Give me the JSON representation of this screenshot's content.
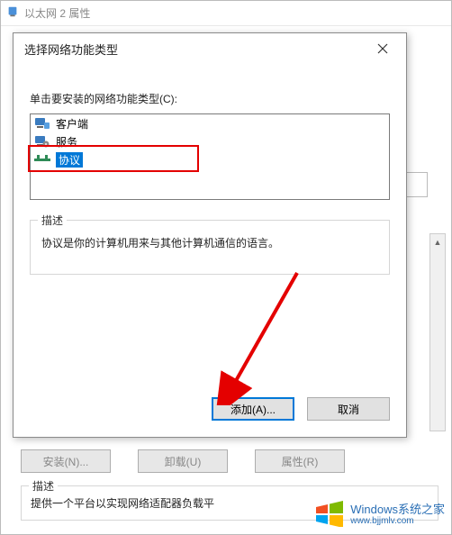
{
  "parent": {
    "title": "以太网 2 属性",
    "buttons": {
      "install": "安装(N)...",
      "uninstall": "卸载(U)",
      "properties": "属性(R)"
    },
    "description_legend": "描述",
    "description_text": "提供一个平台以实现网络适配器负载平"
  },
  "dialog": {
    "title": "选择网络功能类型",
    "instruction": "单击要安装的网络功能类型(C):",
    "items": [
      {
        "label": "客户端",
        "icon": "client"
      },
      {
        "label": "服务",
        "icon": "service"
      },
      {
        "label": "协议",
        "icon": "protocol"
      }
    ],
    "selected_index": 2,
    "description_legend": "描述",
    "description_text": "协议是你的计算机用来与其他计算机通信的语言。",
    "buttons": {
      "add": "添加(A)...",
      "cancel": "取消"
    }
  },
  "watermark": {
    "brand": "Windows",
    "suffix": "系统之家",
    "url": "www.bjjmlv.com"
  }
}
